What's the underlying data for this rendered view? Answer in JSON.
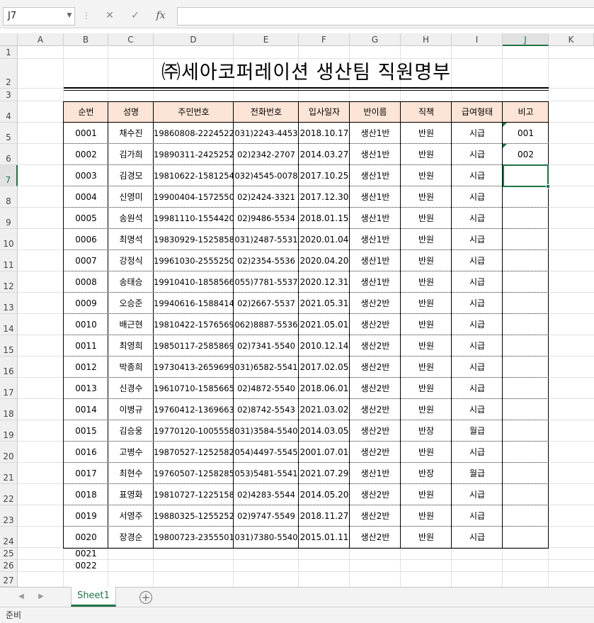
{
  "name_box": {
    "value": "J7"
  },
  "formula_bar": {
    "cancel_icon": "✕",
    "enter_icon": "✓",
    "fx_label": "fx",
    "value": ""
  },
  "columns": [
    "A",
    "B",
    "C",
    "D",
    "E",
    "F",
    "G",
    "H",
    "I",
    "J",
    "K"
  ],
  "selected_column": "J",
  "rows": [
    "1",
    "2",
    "3",
    "4",
    "5",
    "6",
    "7",
    "8",
    "9",
    "10",
    "11",
    "12",
    "13",
    "14",
    "15",
    "16",
    "17",
    "18",
    "19",
    "20",
    "21",
    "22",
    "23",
    "24",
    "25",
    "26",
    "27"
  ],
  "selected_row": "7",
  "title": "㈜세아코퍼레이션 생산팀 직원명부",
  "table": {
    "headers": [
      "순번",
      "성명",
      "주민번호",
      "전화번호",
      "입사일자",
      "반이름",
      "직책",
      "급여형태",
      "비고"
    ],
    "header_fill": "#fce4d6",
    "rows": [
      [
        "0001",
        "채수진",
        "19860808-2224522",
        "031)2243-4453",
        "2018.10.17",
        "생산1반",
        "반원",
        "시급",
        "001"
      ],
      [
        "0002",
        "김가희",
        "19890311-2425252",
        "02)2342-2707",
        "2014.03.27",
        "생산1반",
        "반원",
        "시급",
        "002"
      ],
      [
        "0003",
        "김경모",
        "19810622-1581254",
        "032)4545-0078",
        "2017.10.25",
        "생산1반",
        "반원",
        "시급",
        ""
      ],
      [
        "0004",
        "신영미",
        "19900404-1572550",
        "02)2424-3321",
        "2017.12.30",
        "생산1반",
        "반원",
        "시급",
        ""
      ],
      [
        "0005",
        "송원석",
        "19981110-1554420",
        "02)9486-5534",
        "2018.01.15",
        "생산1반",
        "반원",
        "시급",
        ""
      ],
      [
        "0006",
        "최명석",
        "19830929-1525858",
        "031)2487-5531",
        "2020.01.04",
        "생산1반",
        "반원",
        "시급",
        ""
      ],
      [
        "0007",
        "강정식",
        "19961030-2555250",
        "02)2354-5536",
        "2020.04.20",
        "생산1반",
        "반원",
        "시급",
        ""
      ],
      [
        "0008",
        "송태승",
        "19910410-1858566",
        "055)7781-5537",
        "2020.12.31",
        "생산1반",
        "반원",
        "시급",
        ""
      ],
      [
        "0009",
        "오승준",
        "19940616-1588414",
        "02)2667-5537",
        "2021.05.31",
        "생산2반",
        "반원",
        "시급",
        ""
      ],
      [
        "0010",
        "배근현",
        "19810422-1576569",
        "062)8887-5536",
        "2021.05.01",
        "생산2반",
        "반원",
        "시급",
        ""
      ],
      [
        "0011",
        "최영희",
        "19850117-2585869",
        "02)7341-5540",
        "2010.12.14",
        "생산2반",
        "반원",
        "시급",
        ""
      ],
      [
        "0012",
        "박종희",
        "19730413-2659699",
        "031)6582-5541",
        "2017.02.05",
        "생산2반",
        "반원",
        "시급",
        ""
      ],
      [
        "0013",
        "신경수",
        "19610710-1585665",
        "02)4872-5540",
        "2018.06.01",
        "생산2반",
        "반원",
        "시급",
        ""
      ],
      [
        "0014",
        "이병규",
        "19760412-1369663",
        "02)8742-5543",
        "2021.03.02",
        "생산2반",
        "반원",
        "시급",
        ""
      ],
      [
        "0015",
        "김승웅",
        "19770120-1005558",
        "031)3584-5540",
        "2014.03.05",
        "생산2반",
        "반장",
        "월급",
        ""
      ],
      [
        "0016",
        "고병수",
        "19870527-1252582",
        "054)4497-5545",
        "2001.07.01",
        "생산2반",
        "반원",
        "시급",
        ""
      ],
      [
        "0017",
        "최현수",
        "19760507-1258285",
        "053)5481-5541",
        "2021.07.29",
        "생산1반",
        "반장",
        "월급",
        ""
      ],
      [
        "0018",
        "표영화",
        "19810727-1225158",
        "02)4283-5544",
        "2014.05.20",
        "생산2반",
        "반원",
        "시급",
        ""
      ],
      [
        "0019",
        "서영주",
        "19880325-1255252",
        "02)9747-5549",
        "2018.11.27",
        "생산2반",
        "반원",
        "시급",
        ""
      ],
      [
        "0020",
        "장경순",
        "19800723-2355501",
        "031)7380-5540",
        "2015.01.11",
        "생산2반",
        "반원",
        "시급",
        ""
      ]
    ],
    "extra": [
      "0021",
      "0022"
    ]
  },
  "sheet_tabs": [
    "Sheet1"
  ],
  "status": "준비",
  "accent_color": "#217346"
}
